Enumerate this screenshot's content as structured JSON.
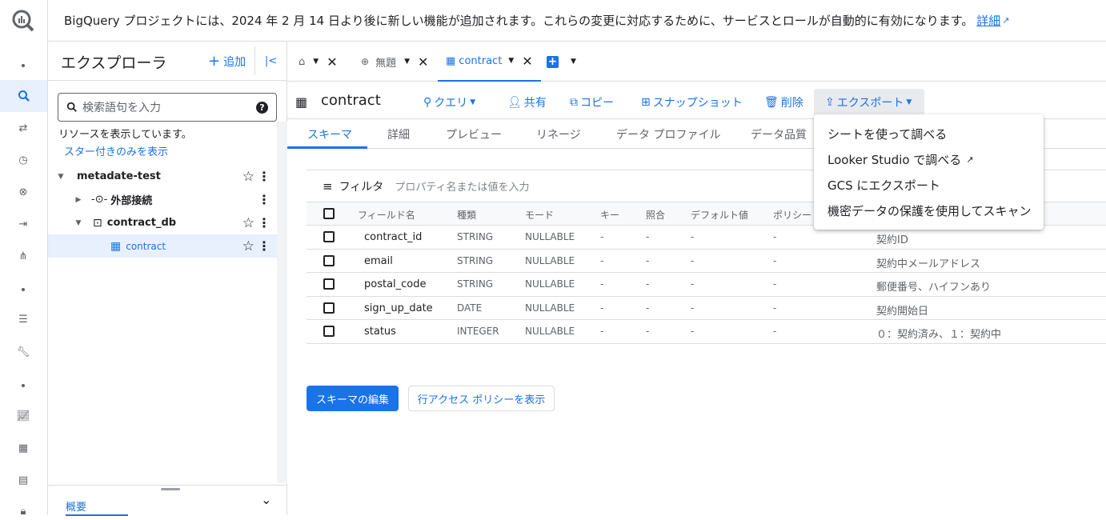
{
  "banner": {
    "text": "BigQuery プロジェクトには、2024 年 2 月 14 日より後に新しい機能が追加されます。これらの変更に対応するために、サービスとロールが自動的に有効になります。",
    "link": "詳細"
  },
  "explorer": {
    "title": "エクスプローラ",
    "add": "追加",
    "search_placeholder": "検索語句を入力",
    "showing": "リソースを表示しています。",
    "starred_only": "スター付きのみを表示",
    "tree": [
      {
        "label": "metadate-test"
      },
      {
        "label": "外部接続"
      },
      {
        "label": "contract_db"
      },
      {
        "label": "contract"
      }
    ],
    "bottom_tab": "概要"
  },
  "tabs": [
    {
      "label": ""
    },
    {
      "label": "無題"
    },
    {
      "label": "contract"
    }
  ],
  "toolbar": {
    "resource_name": "contract",
    "query": "クエリ",
    "share": "共有",
    "copy": "コピー",
    "snapshot": "スナップショット",
    "delete": "削除",
    "export": "エクスポート"
  },
  "subtabs": [
    "スキーマ",
    "詳細",
    "プレビュー",
    "リネージ",
    "データ プロファイル",
    "データ品質"
  ],
  "schema": {
    "filter_label": "フィルタ",
    "filter_placeholder": "プロパティ名または値を入力",
    "columns": [
      "フィールド名",
      "種類",
      "モード",
      "キー",
      "照合",
      "デフォルト値",
      "ポリシー"
    ],
    "rows": [
      {
        "name": "contract_id",
        "type": "STRING",
        "mode": "NULLABLE",
        "key": "-",
        "collation": "-",
        "default": "-",
        "policy": "-",
        "desc": "契約ID"
      },
      {
        "name": "email",
        "type": "STRING",
        "mode": "NULLABLE",
        "key": "-",
        "collation": "-",
        "default": "-",
        "policy": "-",
        "desc": "契約中メールアドレス"
      },
      {
        "name": "postal_code",
        "type": "STRING",
        "mode": "NULLABLE",
        "key": "-",
        "collation": "-",
        "default": "-",
        "policy": "-",
        "desc": "郵便番号、ハイフンあり"
      },
      {
        "name": "sign_up_date",
        "type": "DATE",
        "mode": "NULLABLE",
        "key": "-",
        "collation": "-",
        "default": "-",
        "policy": "-",
        "desc": "契約開始日"
      },
      {
        "name": "status",
        "type": "INTEGER",
        "mode": "NULLABLE",
        "key": "-",
        "collation": "-",
        "default": "-",
        "policy": "-",
        "desc": "０：契約済み、１：契約中"
      }
    ],
    "edit_button": "スキーマの編集",
    "row_access_button": "行アクセス ポリシーを表示"
  },
  "export_menu": {
    "items": [
      "シートを使って調べる",
      "Looker Studio で調べる",
      "GCS にエクスポート",
      "機密データの保護を使用してスキャン"
    ]
  }
}
